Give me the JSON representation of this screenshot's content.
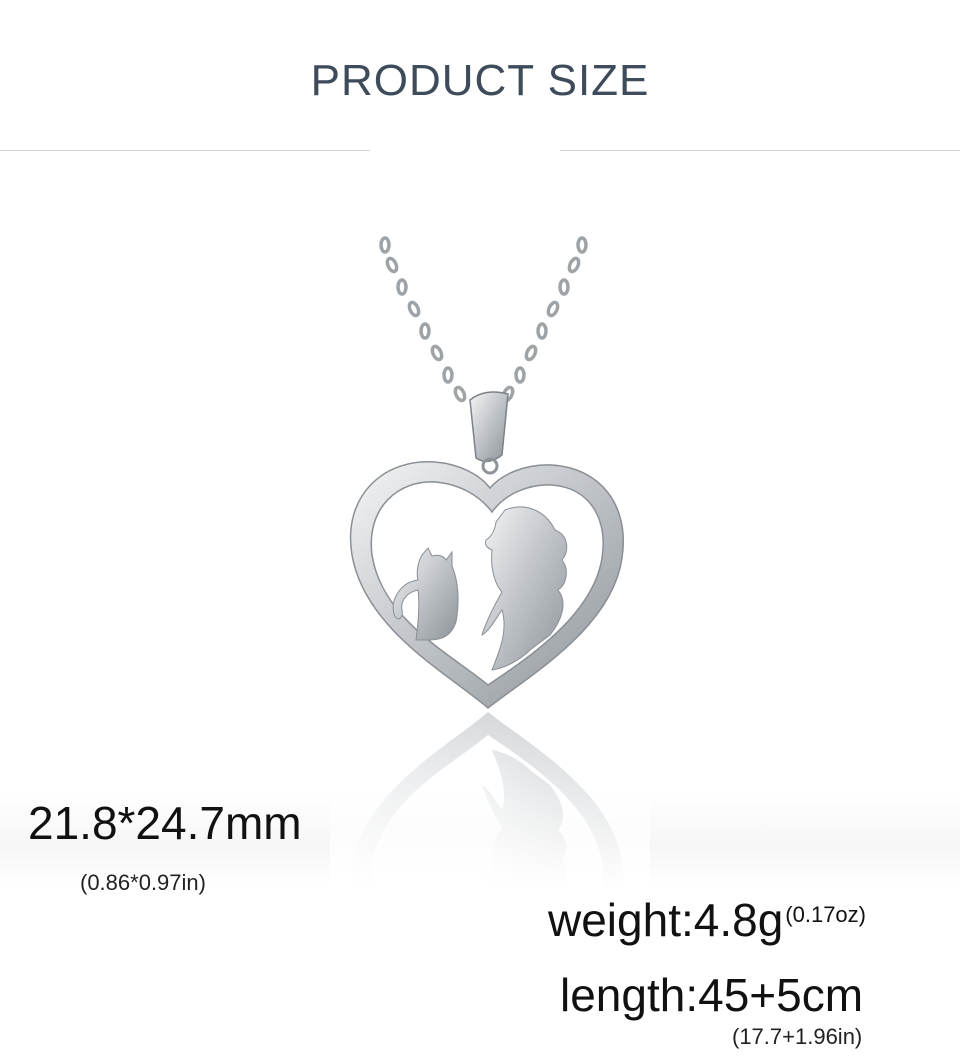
{
  "header": {
    "title": "PRODUCT SIZE"
  },
  "product": {
    "image_alt": "heart pendant necklace",
    "metal_color": "#c9cdd1"
  },
  "specs": {
    "dimensions": "21.8*24.7mm",
    "dimensions_in": "(0.86*0.97in)",
    "weight": "weight:4.8g",
    "weight_oz": "(0.17oz)",
    "length": "length:45+5cm",
    "length_in": "(17.7+1.96in)"
  }
}
